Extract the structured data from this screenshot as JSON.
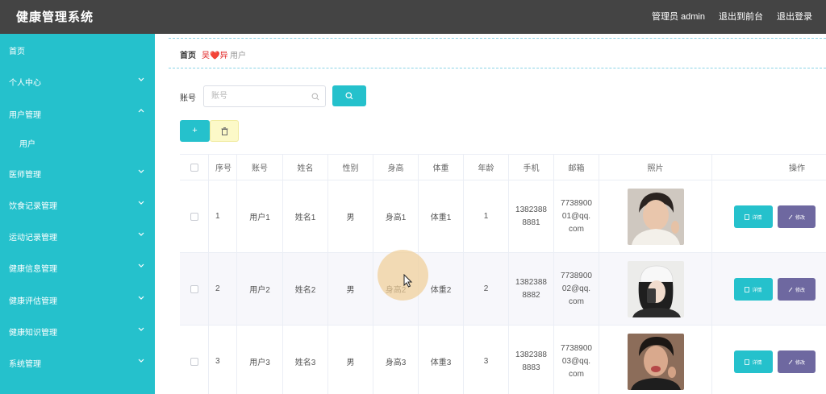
{
  "header": {
    "title": "健康管理系统",
    "admin_label": "管理员 admin",
    "exit_front_label": "退出到前台",
    "logout_label": "退出登录"
  },
  "sidebar": {
    "items": [
      {
        "label": "首页"
      },
      {
        "label": "个人中心"
      },
      {
        "label": "用户管理"
      },
      {
        "label": "用户"
      },
      {
        "label": "医师管理"
      },
      {
        "label": "饮食记录管理"
      },
      {
        "label": "运动记录管理"
      },
      {
        "label": "健康信息管理"
      },
      {
        "label": "健康评估管理"
      },
      {
        "label": "健康知识管理"
      },
      {
        "label": "系统管理"
      }
    ]
  },
  "breadcrumb": {
    "home": "首页",
    "middle": "吴❤️异",
    "current": "用户"
  },
  "search": {
    "label": "账号",
    "placeholder": "账号",
    "value": ""
  },
  "toolbar": {
    "add_label": "+",
    "delete_icon": "trash-icon"
  },
  "table": {
    "headers": [
      "序号",
      "账号",
      "姓名",
      "性别",
      "身高",
      "体重",
      "年龄",
      "手机",
      "邮箱",
      "照片",
      "操作"
    ],
    "rows": [
      {
        "index": "1",
        "account": "用户1",
        "name": "姓名1",
        "gender": "男",
        "height": "身高1",
        "weight": "体重1",
        "age": "1",
        "phone_l1": "1382388",
        "phone_l2": "8881",
        "email_l1": "7738900",
        "email_l2": "01@qq.",
        "email_l3": "com"
      },
      {
        "index": "2",
        "account": "用户2",
        "name": "姓名2",
        "gender": "男",
        "height": "身高2",
        "weight": "体重2",
        "age": "2",
        "phone_l1": "1382388",
        "phone_l2": "8882",
        "email_l1": "7738900",
        "email_l2": "02@qq.",
        "email_l3": "com"
      },
      {
        "index": "3",
        "account": "用户3",
        "name": "姓名3",
        "gender": "男",
        "height": "身高3",
        "weight": "体重3",
        "age": "3",
        "phone_l1": "1382388",
        "phone_l2": "8883",
        "email_l1": "7738900",
        "email_l2": "03@qq.",
        "email_l3": "com"
      }
    ],
    "detail_label": "详情",
    "edit_label": "修改"
  },
  "colors": {
    "accent": "#25c1cc",
    "topbar": "#444444",
    "edit_button": "#6e68a0",
    "delete_button": "#fcf9c8"
  }
}
